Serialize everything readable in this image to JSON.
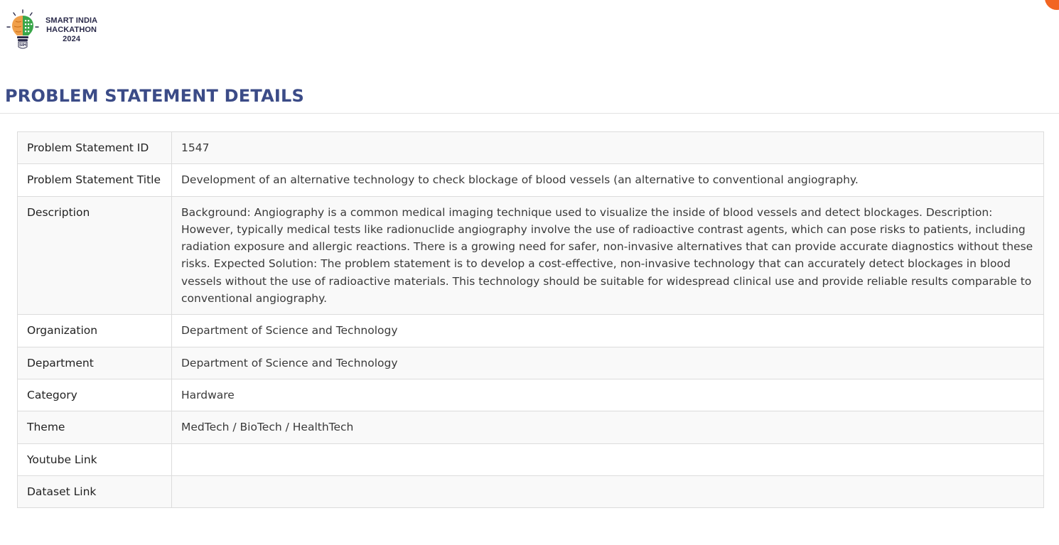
{
  "logo": {
    "line1": "SMART INDIA",
    "line2": "HACKATHON",
    "line3": "2024",
    "badge": "SIH"
  },
  "page_title": "PROBLEM STATEMENT DETAILS",
  "colors": {
    "title": "#3b4b87",
    "accent_orange": "#f26522",
    "brain_left": "#f0a04b",
    "brain_right": "#3aa64a"
  },
  "rows": [
    {
      "label": "Problem Statement ID",
      "value": "1547"
    },
    {
      "label": "Problem Statement Title",
      "value": "Development of an alternative technology to check blockage of blood vessels (an alternative to conventional angiography."
    },
    {
      "label": "Description",
      "value": "Background: Angiography is a common medical imaging technique used to visualize the inside of blood vessels and detect blockages. Description: However, typically medical tests like radionuclide angiography involve the use of radioactive contrast agents, which can pose risks to patients, including radiation exposure and allergic reactions. There is a growing need for safer, non-invasive alternatives that can provide accurate diagnostics without these risks. Expected Solution: The problem statement is to develop a cost-effective, non-invasive technology that can accurately detect blockages in blood vessels without the use of radioactive materials. This technology should be suitable for widespread clinical use and provide reliable results comparable to conventional angiography."
    },
    {
      "label": "Organization",
      "value": "Department of Science and Technology"
    },
    {
      "label": "Department",
      "value": "Department of Science and Technology"
    },
    {
      "label": "Category",
      "value": "Hardware"
    },
    {
      "label": "Theme",
      "value": "MedTech / BioTech / HealthTech"
    },
    {
      "label": "Youtube Link",
      "value": ""
    },
    {
      "label": "Dataset Link",
      "value": ""
    }
  ]
}
